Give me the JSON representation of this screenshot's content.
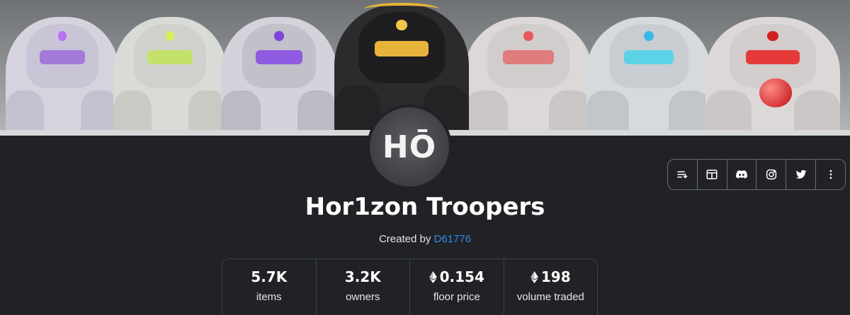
{
  "collection": {
    "avatar_logo_text": "HŌ",
    "title": "Hor1zon Troopers",
    "created_by_prefix": "Created by",
    "creator": "D61776"
  },
  "social_links": [
    {
      "icon": "list-icon",
      "label": "Activity"
    },
    {
      "icon": "website-icon",
      "label": "Website"
    },
    {
      "icon": "discord-icon",
      "label": "Discord"
    },
    {
      "icon": "instagram-icon",
      "label": "Instagram"
    },
    {
      "icon": "twitter-icon",
      "label": "Twitter"
    },
    {
      "icon": "more-icon",
      "label": "More"
    }
  ],
  "stats": [
    {
      "value": "5.7K",
      "label": "items",
      "eth": false
    },
    {
      "value": "3.2K",
      "label": "owners",
      "eth": false
    },
    {
      "value": "0.154",
      "label": "floor price",
      "eth": true
    },
    {
      "value": "198",
      "label": "volume traded",
      "eth": true
    }
  ],
  "colors": {
    "background": "#202225",
    "link": "#2f8ce6",
    "border": "#6a6d72"
  }
}
